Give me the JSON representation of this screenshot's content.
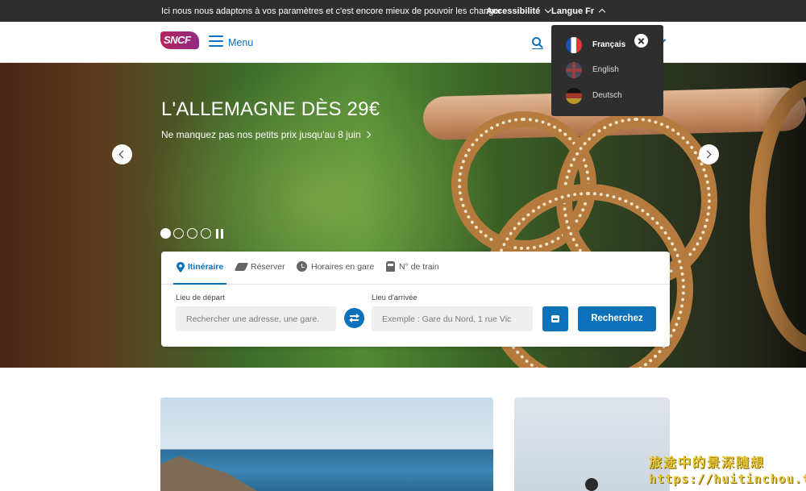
{
  "topbar": {
    "message": "Ici nous nous adaptons à vos paramètres et c'est encore mieux de pouvoir les changer",
    "accessibility_label": "Accessibilité",
    "language_label": "Langue Fr"
  },
  "header": {
    "logo_text": "SNCF",
    "menu_label": "Menu",
    "brand_color": "#0c71b9"
  },
  "hero": {
    "title": "L'ALLEMAGNE DÈS 29€",
    "subtitle": "Ne manquez pas nos petits prix jusqu'au 8 juin",
    "slide_count": 4,
    "active_slide": 1
  },
  "booking": {
    "tabs": [
      {
        "label": "Itinéraire",
        "icon": "pin-icon",
        "active": true
      },
      {
        "label": "Réserver",
        "icon": "ticket-icon",
        "active": false
      },
      {
        "label": "Horaires en gare",
        "icon": "clock-icon",
        "active": false
      },
      {
        "label": "N° de train",
        "icon": "train-icon",
        "active": false
      }
    ],
    "departure_label": "Lieu de départ",
    "departure_placeholder": "Rechercher une adresse, une gare.",
    "arrival_label": "Lieu d'arrivée",
    "arrival_placeholder": "Exemple : Gare du Nord, 1 rue Vic",
    "search_button": "Recherchez"
  },
  "language_menu": {
    "items": [
      {
        "label": "Français",
        "flag": "flag-fr",
        "current": true
      },
      {
        "label": "English",
        "flag": "flag-en",
        "current": false
      },
      {
        "label": "Deutsch",
        "flag": "flag-de",
        "current": false
      }
    ]
  },
  "watermark": {
    "line1": "旅途中的景深隨想",
    "line2": "https://huitinchou.tw"
  }
}
